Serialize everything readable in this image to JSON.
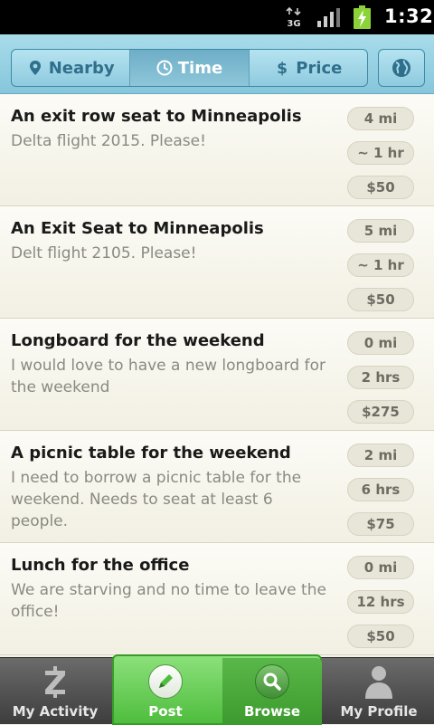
{
  "status_bar": {
    "network": "3G",
    "time": "1:32"
  },
  "sort_tabs": [
    {
      "label": "Nearby",
      "icon": "map-pin-icon",
      "active": false
    },
    {
      "label": "Time",
      "icon": "clock-icon",
      "active": true
    },
    {
      "label": "Price",
      "icon": "dollar-icon",
      "active": false
    }
  ],
  "globe_button": {
    "icon": "globe-icon"
  },
  "listings": [
    {
      "title": "An exit row seat to Minneapolis",
      "description": "Delta flight 2015. Please!",
      "distance": "4 mi",
      "time": "~ 1 hr",
      "price": "$50"
    },
    {
      "title": "An Exit Seat to Minneapolis",
      "description": "Delt flight 2105. Please!",
      "distance": "5 mi",
      "time": "~ 1 hr",
      "price": "$50"
    },
    {
      "title": "Longboard for the weekend",
      "description": "I would love to have a new longboard for the weekend",
      "distance": "0 mi",
      "time": "2 hrs",
      "price": "$275"
    },
    {
      "title": "A picnic table for the weekend",
      "description": "I need to borrow a picnic table for the weekend. Needs to seat at least 6 people.",
      "distance": "2 mi",
      "time": "6 hrs",
      "price": "$75"
    },
    {
      "title": "Lunch for the office",
      "description": "We are starving and no time to leave the office!",
      "distance": "0 mi",
      "time": "12 hrs",
      "price": "$50"
    }
  ],
  "bottom_tabs": {
    "activity": "My Activity",
    "post": "Post",
    "browse": "Browse",
    "profile": "My Profile"
  },
  "colors": {
    "accent_green": "#4fbd3d",
    "header_blue": "#86c6db"
  }
}
